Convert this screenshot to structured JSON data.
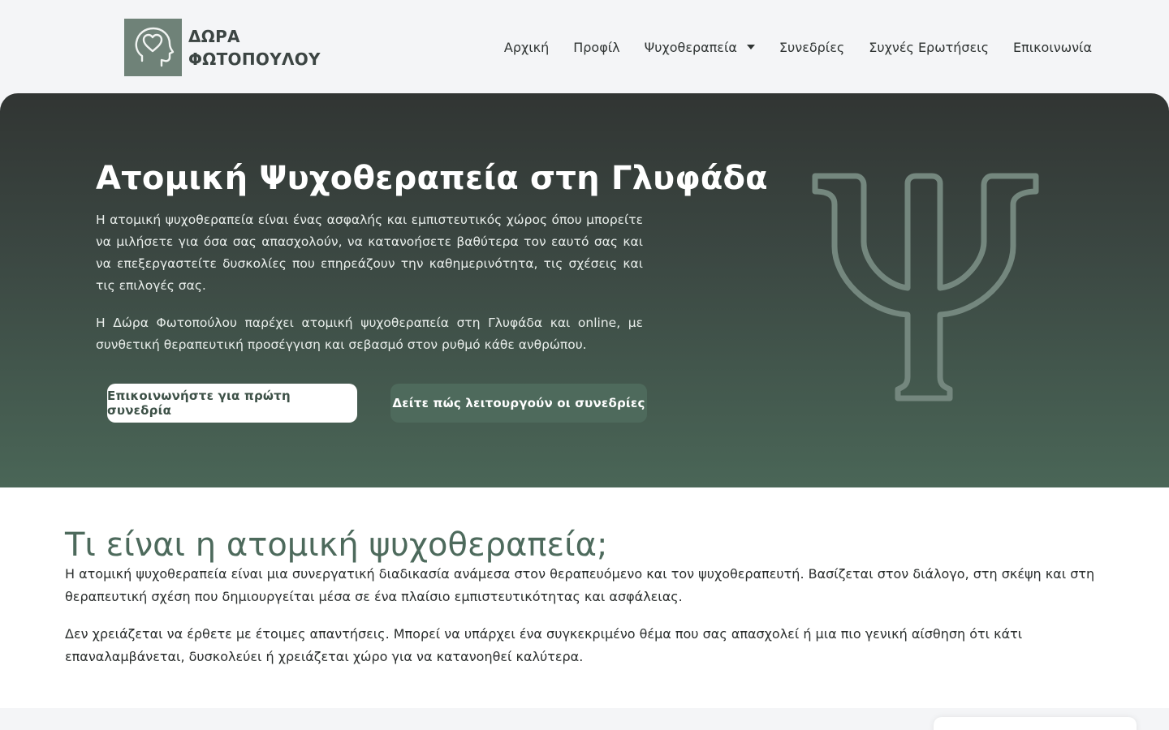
{
  "brand": {
    "line1": "ΔΩΡΑ",
    "line2": "ΦΩΤΟΠΟΥΛΟΥ",
    "logo_icon": "heart-head-icon",
    "logo_color": "#6f8278"
  },
  "nav": {
    "items": [
      {
        "label": "Αρχική"
      },
      {
        "label": "Προφίλ"
      },
      {
        "label": "Ψυχοθεραπεία",
        "has_dropdown": true
      },
      {
        "label": "Συνεδρίες"
      },
      {
        "label": "Συχνές Ερωτήσεις"
      },
      {
        "label": "Επικοινωνία"
      }
    ]
  },
  "hero": {
    "title": "Ατομική Ψυχοθεραπεία στη Γλυφάδα",
    "paragraph1": "Η ατομική ψυχοθεραπεία είναι ένας ασφαλής και εμπιστευτικός χώρος όπου μπορείτε να μιλήσετε για όσα σας απασχολούν, να κατανοήσετε βαθύτερα τον εαυτό σας και να επεξεργαστείτε δυσκολίες που επηρεάζουν την καθημερινότητα, τις σχέσεις και τις επιλογές σας.",
    "paragraph2": "Η Δώρα Φωτοπούλου παρέχει ατομική ψυχοθεραπεία στη Γλυφάδα και online, με συνθετική θεραπευτική προσέγγιση και σεβασμό στον ρυθμό κάθε ανθρώπου.",
    "primary_button": "Επικοινωνήστε για πρώτη συνεδρία",
    "secondary_button": "Δείτε πώς λειτουργούν οι συνεδρίες",
    "decor_icon": "psi-symbol-icon",
    "colors": {
      "gradient_top": "#313533",
      "gradient_bottom": "#4a6657",
      "accent": "#4e6a5c"
    }
  },
  "section": {
    "title": "Τι είναι η ατομική ψυχοθεραπεία;",
    "paragraph1": "Η ατομική ψυχοθεραπεία είναι μια συνεργατική διαδικασία ανάμεσα στον θεραπευόμενο και τον ψυχοθεραπευτή. Βασίζεται στον διάλογο, στη σκέψη και στη θεραπευτική σχέση που δημιουργείται μέσα σε ένα πλαίσιο εμπιστευτικότητας και ασφάλειας.",
    "paragraph2": "Δεν χρειάζεται να έρθετε με έτοιμες απαντήσεις. Μπορεί να υπάρχει ένα συγκεκριμένο θέμα που σας απασχολεί ή μια πιο γενική αίσθηση ότι κάτι επαναλαμβάνεται, δυσκολεύει ή χρειάζεται χώρο για να κατανοηθεί καλύτερα.",
    "title_color": "#4d6a5c"
  }
}
